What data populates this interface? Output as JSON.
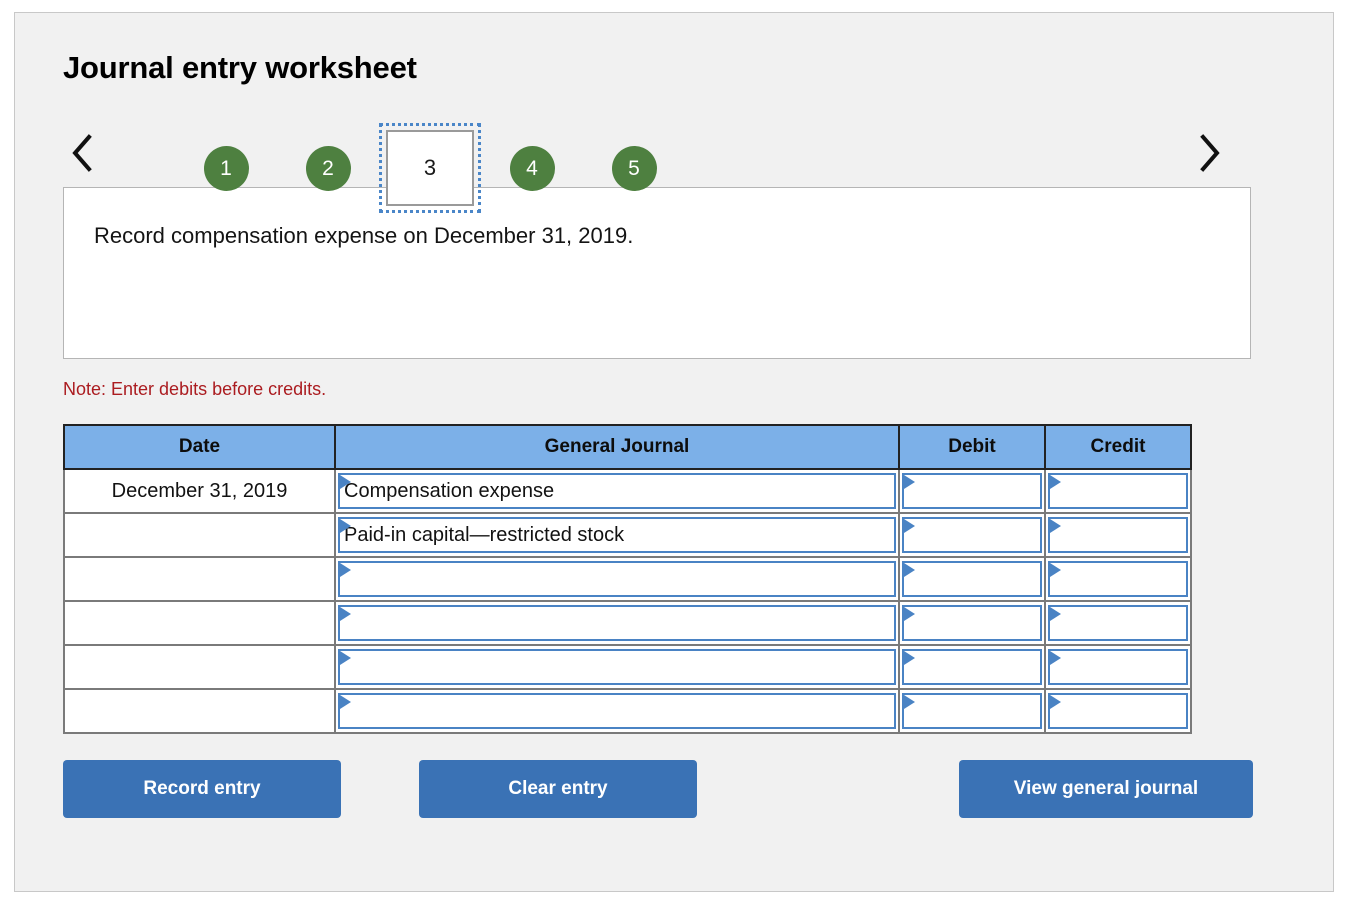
{
  "header": {
    "title": "Journal entry worksheet"
  },
  "stepper": {
    "prev_icon": "chevron-left-icon",
    "next_icon": "chevron-right-icon",
    "current_step": "3",
    "steps": [
      {
        "label": "1",
        "state": "done"
      },
      {
        "label": "2",
        "state": "done"
      },
      {
        "label": "3",
        "state": "current"
      },
      {
        "label": "4",
        "state": "done"
      },
      {
        "label": "5",
        "state": "done"
      }
    ],
    "colors": {
      "step_green": "#4e8040",
      "current_outline": "#4a86c8"
    }
  },
  "description": {
    "text": "Record compensation expense on December 31, 2019."
  },
  "note": {
    "text": "Note: Enter debits before credits.",
    "color": "#ab1c20"
  },
  "table": {
    "header_color": "#7cb0e8",
    "columns": [
      "Date",
      "General Journal",
      "Debit",
      "Credit"
    ],
    "rows": [
      {
        "date": "December 31, 2019",
        "account": "Compensation expense",
        "debit": "",
        "credit": ""
      },
      {
        "date": "",
        "account": "Paid-in capital—restricted stock",
        "debit": "",
        "credit": ""
      },
      {
        "date": "",
        "account": "",
        "debit": "",
        "credit": ""
      },
      {
        "date": "",
        "account": "",
        "debit": "",
        "credit": ""
      },
      {
        "date": "",
        "account": "",
        "debit": "",
        "credit": ""
      },
      {
        "date": "",
        "account": "",
        "debit": "",
        "credit": ""
      }
    ]
  },
  "actions": {
    "record_label": "Record entry",
    "clear_label": "Clear entry",
    "view_label": "View general journal",
    "button_color": "#3a72b5"
  }
}
